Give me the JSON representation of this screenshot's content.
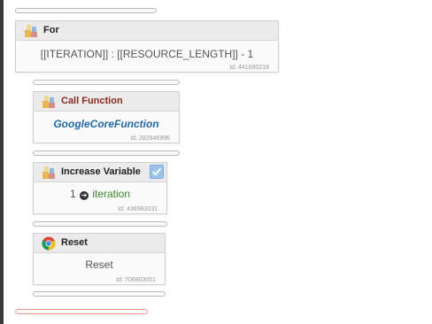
{
  "blocks": {
    "for_loop": {
      "title": "For",
      "expression": "[[ITERATION]] : [[RESOURCE_LENGTH]] - 1",
      "id_text": "Id: 441680218",
      "icon": "puzzle-block-icon"
    },
    "call_function": {
      "title": "Call Function",
      "function_name": "GoogleCoreFunction",
      "id_text": "Id: 282846996",
      "icon": "puzzle-block-icon"
    },
    "increase_variable": {
      "title": "Increase Variable",
      "amount": "1",
      "arrow_glyph": "➔",
      "variable_name": "iteration",
      "id_text": "Id: 436983031",
      "icon": "puzzle-block-icon",
      "checkbox_checked": true
    },
    "reset": {
      "title": "Reset",
      "body": "Reset",
      "id_text": "Id: 706903051",
      "icon": "chrome-icon"
    }
  },
  "colors": {
    "function_title": "#8a2a1c",
    "function_link": "#2369a8",
    "variable_name": "#3d8a2c",
    "error_connector": "#f19a9a",
    "checkbox_badge": "#9cc3ee"
  }
}
